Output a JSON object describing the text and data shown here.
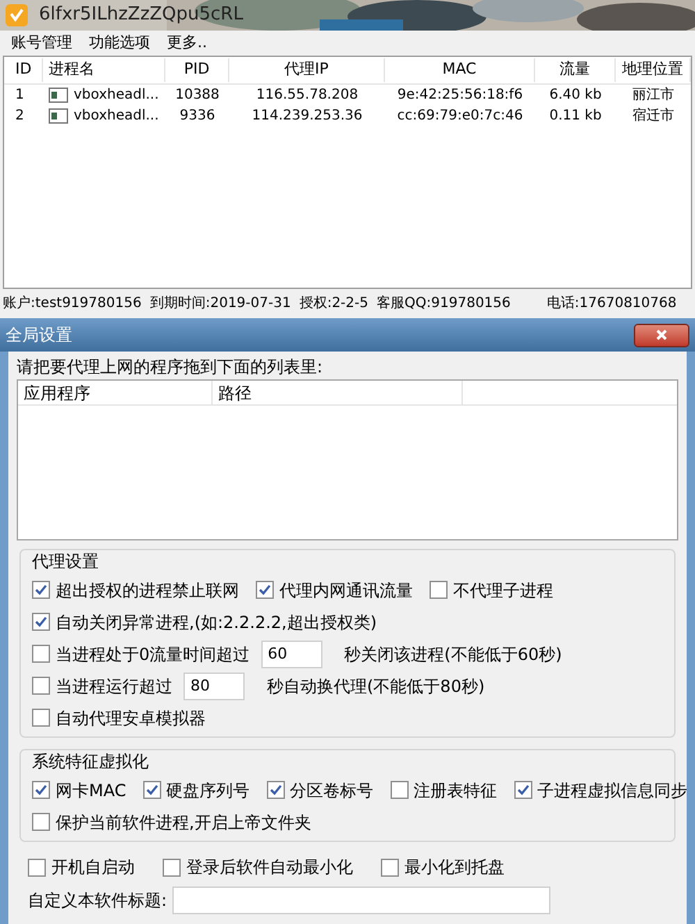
{
  "window": {
    "title": "6lfxr5ILhzZzZQpu5cRL"
  },
  "menu": [
    "账号管理",
    "功能选项",
    "更多.."
  ],
  "table": {
    "columns": [
      "ID",
      "进程名",
      "PID",
      "代理IP",
      "MAC",
      "流量",
      "地理位置"
    ],
    "rows": [
      [
        "1",
        "vboxheadl...",
        "10388",
        "116.55.78.208",
        "9e:42:25:56:18:f6",
        "6.40 kb",
        "丽江市"
      ],
      [
        "2",
        "vboxheadl...",
        "9336",
        "114.239.253.36",
        "cc:69:79:e0:7c:46",
        "0.11 kb",
        "宿迁市"
      ]
    ]
  },
  "status_bar": [
    "账户:test919780156",
    "到期时间:2019-07-31",
    "授权:2-2-5",
    "客服QQ:919780156",
    "电话:17670810768"
  ],
  "dialog": {
    "title": "全局设置",
    "instruction": "请把要代理上网的程序拖到下面的列表里:",
    "list_columns": [
      "应用程序",
      "路径"
    ],
    "proxy_group": {
      "title": "代理设置",
      "rows": [
        [
          {
            "kind": "checkbox",
            "label": "超出授权的进程禁止联网",
            "checked": true
          },
          {
            "kind": "checkbox",
            "label": "代理内网通讯流量",
            "checked": true
          },
          {
            "kind": "checkbox",
            "label": "不代理子进程",
            "checked": false
          }
        ],
        [
          {
            "kind": "checkbox",
            "label": "自动关闭异常进程,(如:2.2.2.2,超出授权类)",
            "checked": true
          }
        ],
        [
          {
            "kind": "timed",
            "label": "当进程处于0流量时间超过",
            "checked": false,
            "value": "60",
            "suffix": "秒关闭该进程(不能低于60秒)"
          }
        ],
        [
          {
            "kind": "timed",
            "label": "当进程运行超过",
            "checked": false,
            "value": "80",
            "suffix": "秒自动换代理(不能低于80秒)"
          }
        ],
        [
          {
            "kind": "checkbox",
            "label": "自动代理安卓模拟器",
            "checked": false
          }
        ]
      ]
    },
    "system_group": {
      "title": "系统特征虚拟化",
      "rows": [
        [
          {
            "kind": "checkbox",
            "label": "网卡MAC",
            "checked": true
          },
          {
            "kind": "checkbox",
            "label": "硬盘序列号",
            "checked": true
          },
          {
            "kind": "checkbox",
            "label": "分区卷标号",
            "checked": true
          },
          {
            "kind": "checkbox",
            "label": "注册表特征",
            "checked": false
          },
          {
            "kind": "checkbox",
            "label": "子进程虚拟信息同步",
            "checked": true
          }
        ],
        [
          {
            "kind": "checkbox",
            "label": "保护当前软件进程,开启上帝文件夹",
            "checked": false
          }
        ]
      ]
    },
    "startup_options": [
      {
        "kind": "checkbox",
        "label": "开机自启动",
        "checked": false
      },
      {
        "kind": "checkbox",
        "label": "登录后软件自动最小化",
        "checked": false
      },
      {
        "kind": "checkbox",
        "label": "最小化到托盘",
        "checked": false
      }
    ],
    "custom_title": {
      "label": "自定义本软件标题:"
    }
  }
}
